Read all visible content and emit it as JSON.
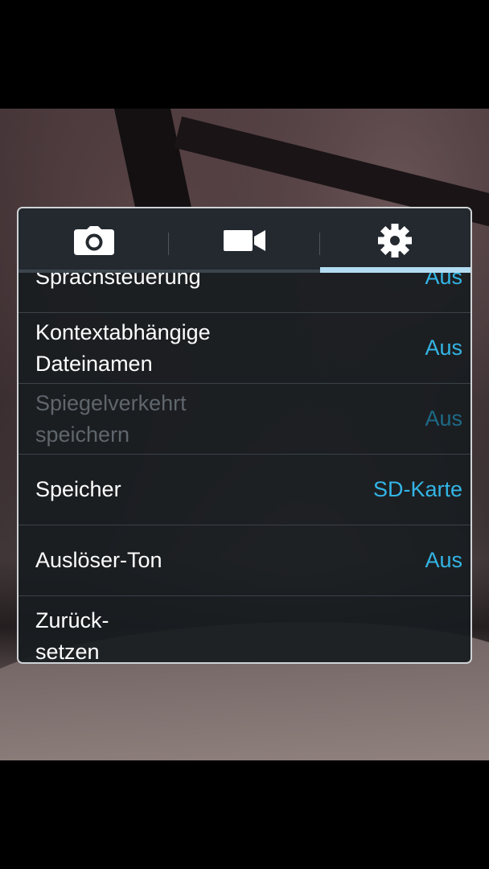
{
  "tabs": [
    {
      "name": "camera",
      "icon": "camera-icon"
    },
    {
      "name": "video",
      "icon": "video-camera-icon"
    },
    {
      "name": "settings",
      "icon": "gear-icon",
      "active": true
    }
  ],
  "settings": {
    "items": [
      {
        "label": "Sprachsteuerung",
        "value": "Aus",
        "enabled": true
      },
      {
        "label": "Kontextabhängige\nDateinamen",
        "value": "Aus",
        "enabled": true
      },
      {
        "label": "Spiegelverkehrt\nspeichern",
        "value": "Aus",
        "enabled": false
      },
      {
        "label": "Speicher",
        "value": "SD-Karte",
        "enabled": true
      },
      {
        "label": "Auslöser-Ton",
        "value": "Aus",
        "enabled": true
      },
      {
        "label": "Zurück-\nsetzen",
        "value": "",
        "enabled": true
      }
    ]
  },
  "colors": {
    "accent": "#33b5e5",
    "tab_indicator": "#b3dcf2",
    "panel_border": "#cfd3d6"
  }
}
